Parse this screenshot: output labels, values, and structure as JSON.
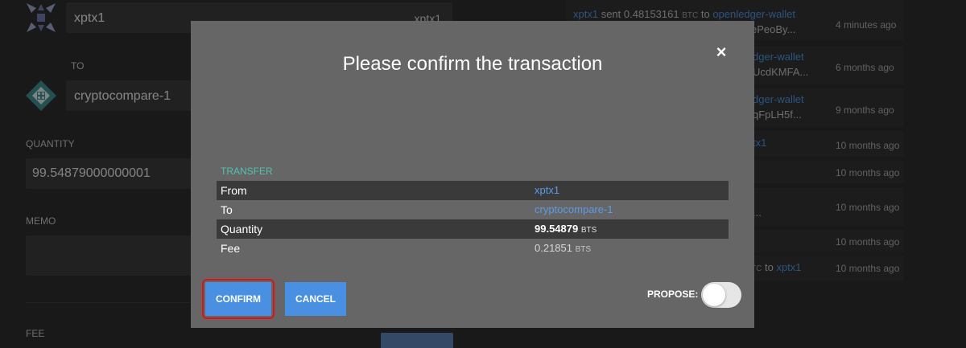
{
  "transfer_form": {
    "from_account": "xptx1",
    "from_account_right": "xptx1",
    "to_label": "TO",
    "to_account": "cryptocompare-1",
    "quantity_label": "QUANTITY",
    "quantity_value": "99.54879000000001",
    "memo_label": "MEMO",
    "fee_label": "FEE"
  },
  "activity": {
    "rows": [
      {
        "line1_from": "xptx1",
        "line1_verb": "sent",
        "line1_amount": "0.48153161",
        "line1_unit": "BTC",
        "line1_to_word": "to",
        "line1_to": "openledger-wallet",
        "line2": "ePeoBy...",
        "time": "4 minutes ago"
      },
      {
        "line1": "dger-wallet",
        "line2": "UcdKMFA...",
        "time": "6 months ago"
      },
      {
        "line1": "dger-wallet",
        "line2": "qFpLH5f...",
        "time": "9 months ago"
      },
      {
        "line1": "tx1",
        "time": "10 months ago"
      },
      {
        "time": "10 months ago"
      },
      {
        "line1": "...",
        "time": "10 months ago"
      },
      {
        "time": "10 months ago"
      },
      {
        "line1_unit": "TC",
        "line1_to_word": "to",
        "line1_to": "xptx1",
        "time": "10 months ago"
      }
    ]
  },
  "modal": {
    "title": "Please confirm the transaction",
    "close_glyph": "×",
    "operation_label": "TRANSFER",
    "rows": [
      {
        "key": "From",
        "value": "xptx1"
      },
      {
        "key": "To",
        "value": "cryptocompare-1"
      },
      {
        "key": "Quantity",
        "value": "99.54879",
        "unit": "BTS"
      },
      {
        "key": "Fee",
        "value": "0.21851",
        "unit": "BTS"
      }
    ],
    "confirm_label": "CONFIRM",
    "cancel_label": "CANCEL",
    "propose_label": "PROPOSE:",
    "propose_enabled": false
  },
  "colors": {
    "accent": "#4a90e2",
    "link": "#5b9be6",
    "teal": "#53c2b2",
    "highlight": "#e01212"
  }
}
